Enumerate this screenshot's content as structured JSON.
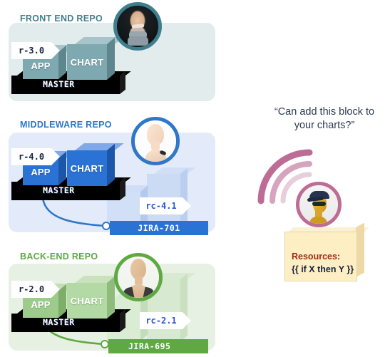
{
  "title": "Repository release flow diagram",
  "colors": {
    "frontend_accent": "#3f7f8c",
    "frontend_panel": "#e2eced",
    "frontend_block": "#7fa9b0",
    "middleware_accent": "#2f77c8",
    "middleware_panel": "#e3ebfa",
    "middleware_block": "#2a72d4",
    "backend_accent": "#5fa843",
    "backend_panel": "#e7f1e3",
    "backend_block": "#9ccb8b",
    "master_bar": "#000000",
    "tag_bg": "#ffffff",
    "signal_arc": "#bd6c96",
    "avatar_ring_pink": "#bd6c96",
    "resources_bg": "#fdeec4",
    "resources_title": "#a32b16",
    "resources_code": "#17243f",
    "quote_text": "#2d3a50"
  },
  "repos": [
    {
      "id": "frontend",
      "label": "FRONT END REPO",
      "tag": "r-3.0",
      "blocks": [
        {
          "name": "APP",
          "label": "APP"
        },
        {
          "name": "CHART",
          "label": "CHART"
        }
      ],
      "branch_label": "MASTER",
      "avatar": {
        "name": "avatar-frontend-owner",
        "alt": "Bald man with headset"
      },
      "feature_branch": null
    },
    {
      "id": "middleware",
      "label": "MIDDLEWARE REPO",
      "tag": "r-4.0",
      "blocks": [
        {
          "name": "APP",
          "label": "APP"
        },
        {
          "name": "CHART",
          "label": "CHART"
        }
      ],
      "branch_label": "MASTER",
      "avatar": {
        "name": "avatar-middleware-owner",
        "alt": "Pale mannequin head"
      },
      "feature_branch": {
        "ticket": "JIRA-701",
        "tag": "rc-4.1",
        "tag_color": "#2a72d4"
      }
    },
    {
      "id": "backend",
      "label": "BACK-END REPO",
      "tag": "r-2.0",
      "blocks": [
        {
          "name": "APP",
          "label": "APP"
        },
        {
          "name": "CHART",
          "label": "CHART"
        }
      ],
      "branch_label": "MASTER",
      "avatar": {
        "name": "avatar-backend-owner",
        "alt": "Tan mannequin bust"
      },
      "feature_branch": {
        "ticket": "JIRA-695",
        "tag": "rc-2.1",
        "tag_color": "#2a56d4"
      }
    }
  ],
  "requester": {
    "quote_line1": "“Can add this block to",
    "quote_line2": "your charts?”",
    "avatar": {
      "name": "avatar-requester",
      "alt": "Gold mannequin head with navy cap and sunglasses"
    },
    "signal_arcs": 3,
    "resources": {
      "title": "Resources:",
      "code": "{{ if X then Y }}"
    }
  }
}
